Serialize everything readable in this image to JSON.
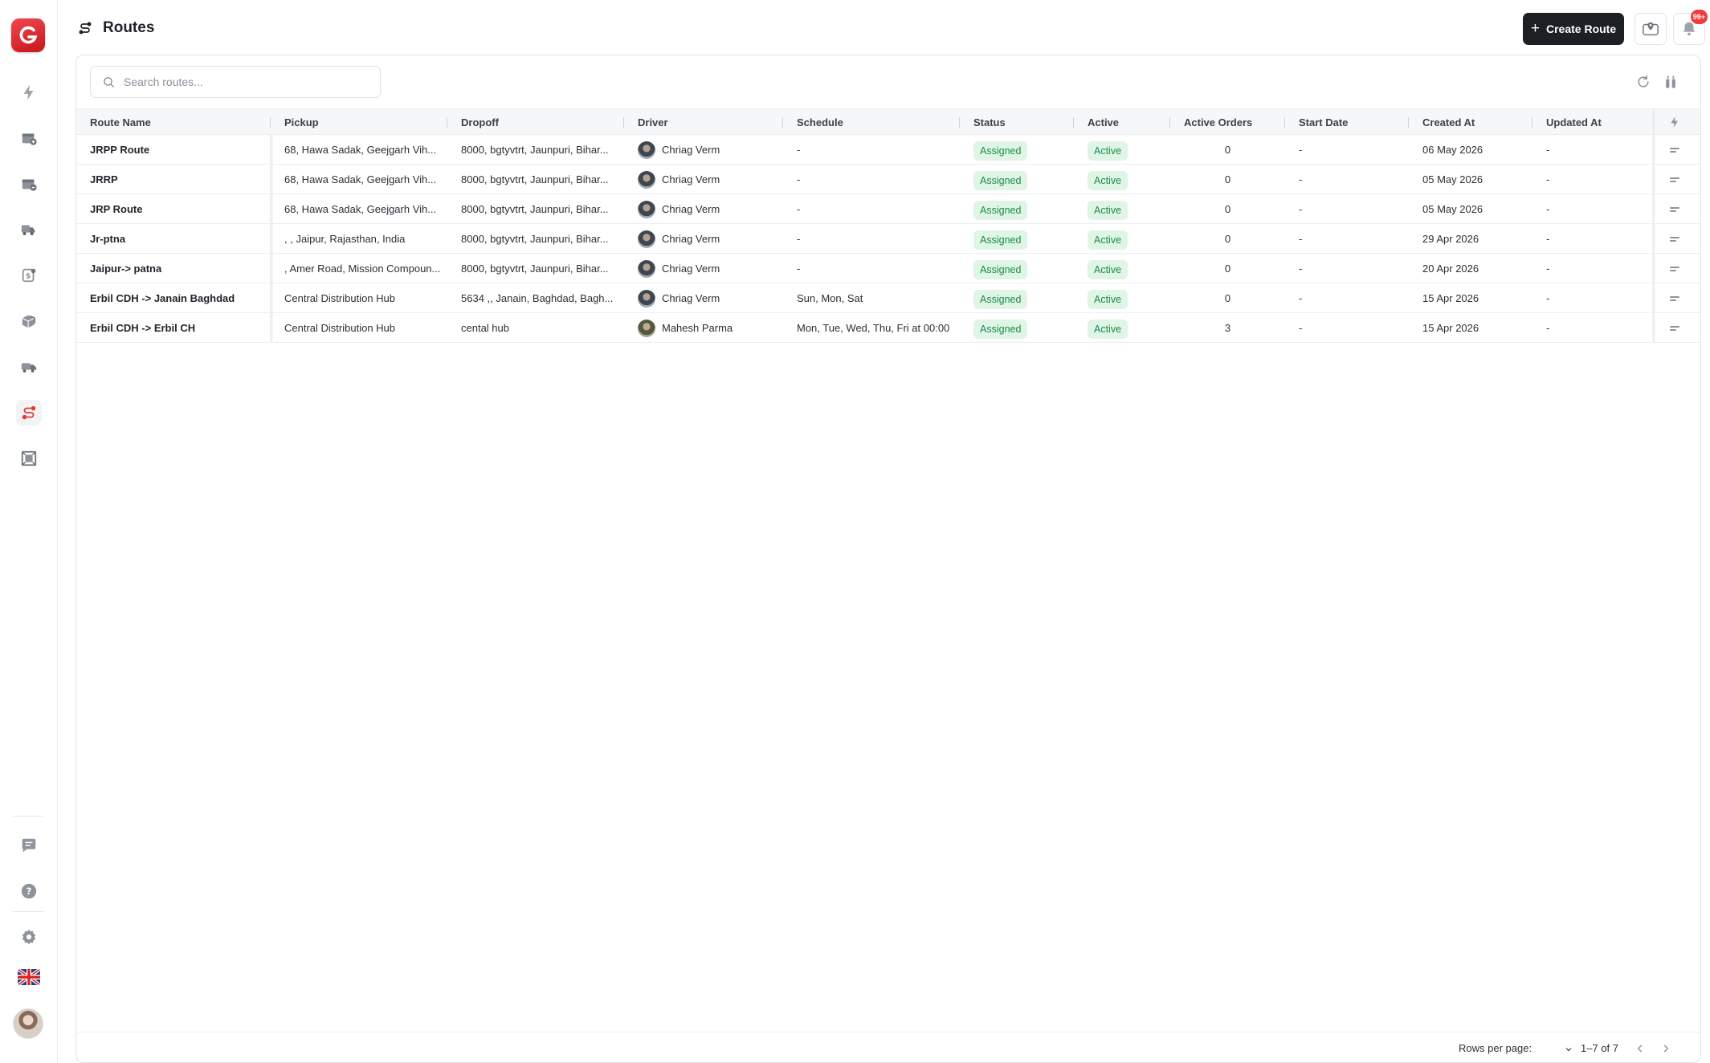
{
  "app": {
    "brand_color": "#d8232a",
    "accent_color": "#1c1f24"
  },
  "sidebar": {
    "items": [
      {
        "name": "lightning-icon",
        "active": false
      },
      {
        "name": "package-in-icon",
        "active": false
      },
      {
        "name": "package-out-icon",
        "active": false
      },
      {
        "name": "delivery-truck-icon",
        "active": false
      },
      {
        "name": "billing-icon",
        "active": false
      },
      {
        "name": "boxes-icon",
        "active": false
      },
      {
        "name": "fleet-truck-icon",
        "active": false
      },
      {
        "name": "route-icon",
        "active": true
      },
      {
        "name": "warehouse-icon",
        "active": false
      }
    ],
    "bottom": [
      "chat-icon",
      "help-icon",
      "settings-icon",
      "uk-flag-icon",
      "user-avatar"
    ]
  },
  "header": {
    "title": "Routes",
    "create_label": "Create Route",
    "notification_count": "99+"
  },
  "search": {
    "placeholder": "Search routes..."
  },
  "table": {
    "columns": [
      "Route Name",
      "Pickup",
      "Dropoff",
      "Driver",
      "Schedule",
      "Status",
      "Active",
      "Active Orders",
      "Start Date",
      "Created At",
      "Updated At"
    ],
    "rows": [
      {
        "route_name": "JRPP Route",
        "pickup": "68, Hawa Sadak, Geejgarh Vih...",
        "dropoff": "8000, bgtyvtrt, Jaunpuri, Bihar...",
        "driver": "Chriag Verm",
        "schedule": "-",
        "status": "Assigned",
        "active": "Active",
        "active_orders": "0",
        "start_date": "-",
        "created_at": "06 May 2026",
        "updated_at": "-"
      },
      {
        "route_name": "JRRP",
        "pickup": "68, Hawa Sadak, Geejgarh Vih...",
        "dropoff": "8000, bgtyvtrt, Jaunpuri, Bihar...",
        "driver": "Chriag Verm",
        "schedule": "-",
        "status": "Assigned",
        "active": "Active",
        "active_orders": "0",
        "start_date": "-",
        "created_at": "05 May 2026",
        "updated_at": "-"
      },
      {
        "route_name": "JRP Route",
        "pickup": "68, Hawa Sadak, Geejgarh Vih...",
        "dropoff": "8000, bgtyvtrt, Jaunpuri, Bihar...",
        "driver": "Chriag Verm",
        "schedule": "-",
        "status": "Assigned",
        "active": "Active",
        "active_orders": "0",
        "start_date": "-",
        "created_at": "05 May 2026",
        "updated_at": "-"
      },
      {
        "route_name": "Jr-ptna",
        "pickup": ", , Jaipur, Rajasthan, India",
        "dropoff": "8000, bgtyvtrt, Jaunpuri, Bihar...",
        "driver": "Chriag Verm",
        "schedule": "-",
        "status": "Assigned",
        "active": "Active",
        "active_orders": "0",
        "start_date": "-",
        "created_at": "29 Apr 2026",
        "updated_at": "-"
      },
      {
        "route_name": "Jaipur-> patna",
        "pickup": ", Amer Road, Mission Compoun...",
        "dropoff": "8000, bgtyvtrt, Jaunpuri, Bihar...",
        "driver": "Chriag Verm",
        "schedule": "-",
        "status": "Assigned",
        "active": "Active",
        "active_orders": "0",
        "start_date": "-",
        "created_at": "20 Apr 2026",
        "updated_at": "-"
      },
      {
        "route_name": "Erbil CDH -> Janain Baghdad",
        "pickup": "Central Distribution Hub",
        "dropoff": "5634 ,, Janain, Baghdad, Bagh...",
        "driver": "Chriag Verm",
        "schedule": "Sun, Mon, Sat",
        "status": "Assigned",
        "active": "Active",
        "active_orders": "0",
        "start_date": "-",
        "created_at": "15 Apr 2026",
        "updated_at": "-"
      },
      {
        "route_name": "Erbil CDH -> Erbil CH",
        "pickup": "Central Distribution Hub",
        "dropoff": "cental hub",
        "driver": "Mahesh Parma",
        "schedule": "Mon, Tue, Wed, Thu, Fri at 00:00",
        "status": "Assigned",
        "active": "Active",
        "active_orders": "3",
        "start_date": "-",
        "created_at": "15 Apr 2026",
        "updated_at": "-"
      }
    ]
  },
  "pagination": {
    "rows_per_page_label": "Rows per page:",
    "range": "1–7 of 7"
  }
}
